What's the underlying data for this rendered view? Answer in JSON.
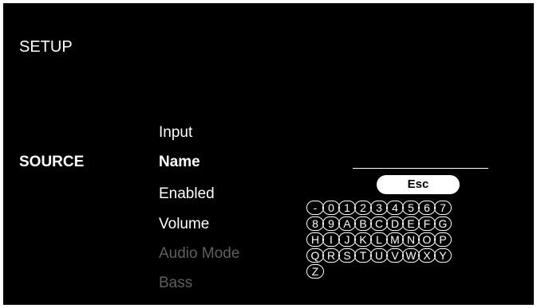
{
  "header": {
    "title": "SETUP"
  },
  "section": {
    "label": "SOURCE"
  },
  "menu": {
    "input": "Input",
    "name": "Name",
    "enabled": "Enabled",
    "volume": "Volume",
    "audio_mode": "Audio Mode",
    "bass": "Bass"
  },
  "keyboard": {
    "esc": "Esc",
    "rows": [
      [
        "-",
        "0",
        "1",
        "2",
        "3",
        "4",
        "5",
        "6",
        "7"
      ],
      [
        "8",
        "9",
        "A",
        "B",
        "C",
        "D",
        "E",
        "F",
        "G"
      ],
      [
        "H",
        "I",
        "J",
        "K",
        "L",
        "M",
        "N",
        "O",
        "P"
      ],
      [
        "Q",
        "R",
        "S",
        "T",
        "U",
        "V",
        "W",
        "X",
        "Y"
      ],
      [
        "Z"
      ]
    ]
  },
  "colors": {
    "background": "#000000",
    "text": "#ffffff",
    "disabled": "#5f5f5f"
  }
}
